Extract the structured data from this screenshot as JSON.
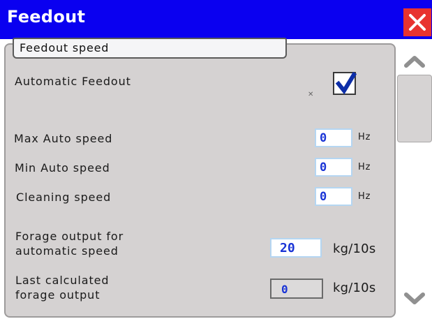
{
  "window": {
    "title": "Feedout"
  },
  "group": {
    "label": "Feedout speed"
  },
  "automatic_feedout": {
    "label": "Automatic Feedout",
    "checked": true
  },
  "rows": [
    {
      "label": "Max Auto speed",
      "value": "0",
      "unit": "Hz"
    },
    {
      "label": "Min Auto speed",
      "value": "0",
      "unit": "Hz"
    },
    {
      "label": "Cleaning speed",
      "value": "0",
      "unit": "Hz"
    }
  ],
  "forage_output": {
    "label_line1": "Forage output for",
    "label_line2": "automatic speed",
    "value": "20",
    "unit": "kg/10s"
  },
  "last_output": {
    "label_line1": "Last calculated",
    "label_line2": "forage output",
    "value": "0",
    "unit": "kg/10s"
  },
  "colors": {
    "titlebar": "#0a00f0",
    "close": "#e8332f",
    "field_value": "#1a34d6",
    "panel": "#d5d2d2"
  },
  "icons": {
    "close": "close-icon",
    "check": "checkmark-icon",
    "up": "chevron-up-icon",
    "down": "chevron-down-icon"
  }
}
